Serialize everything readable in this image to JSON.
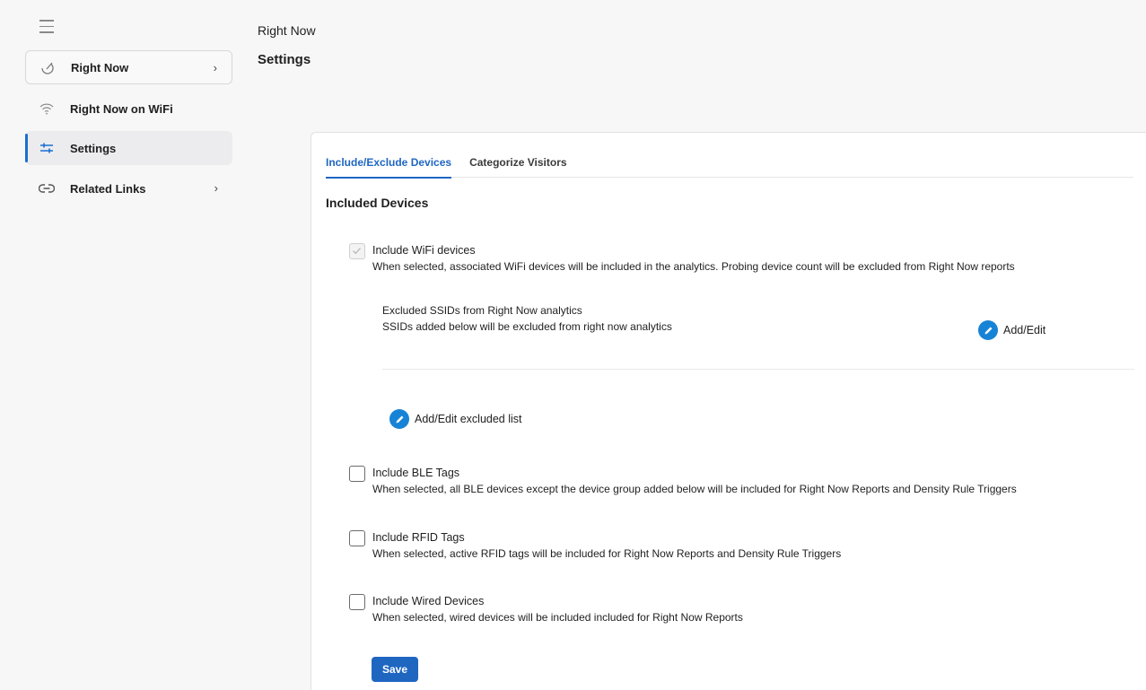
{
  "sidebar": {
    "items": [
      {
        "label": "Right Now",
        "icon": "right-now-icon",
        "has_chevron": true
      },
      {
        "label": "Right Now on WiFi",
        "icon": "wifi-icon",
        "has_chevron": false
      },
      {
        "label": "Settings",
        "icon": "sliders-icon",
        "has_chevron": false,
        "active": true
      },
      {
        "label": "Related Links",
        "icon": "link-icon",
        "has_chevron": true
      }
    ],
    "chevron": "›"
  },
  "header": {
    "breadcrumb": "Right Now",
    "title": "Settings"
  },
  "tabs": [
    {
      "label": "Include/Exclude Devices",
      "active": true
    },
    {
      "label": "Categorize Visitors",
      "active": false
    }
  ],
  "section": {
    "title": "Included Devices"
  },
  "options": {
    "wifi": {
      "label": "Include WiFi devices",
      "desc": "When selected, associated WiFi devices will be included in the analytics. Probing device count will be excluded from Right Now reports",
      "checked": true
    },
    "ble": {
      "label": "Include BLE Tags",
      "desc": "When selected, all BLE devices except the device group added below will be included for Right Now Reports and Density Rule Triggers",
      "checked": false
    },
    "rfid": {
      "label": "Include RFID Tags",
      "desc": "When selected, active RFID tags will be included for Right Now Reports and Density Rule Triggers",
      "checked": false
    },
    "wired": {
      "label": "Include Wired Devices",
      "desc": "When selected, wired devices will be included included for Right Now Reports",
      "checked": false
    }
  },
  "ssid": {
    "title": "Excluded SSIDs from Right Now analytics",
    "desc": "SSIDs added below will be excluded from right now analytics",
    "add_edit_label": "Add/Edit",
    "add_edit_excluded_label": "Add/Edit excluded list"
  },
  "actions": {
    "save_label": "Save"
  },
  "colors": {
    "accent": "#1f66c1",
    "pencil_button": "#1783d6",
    "active_indicator": "#1a6fd1"
  }
}
